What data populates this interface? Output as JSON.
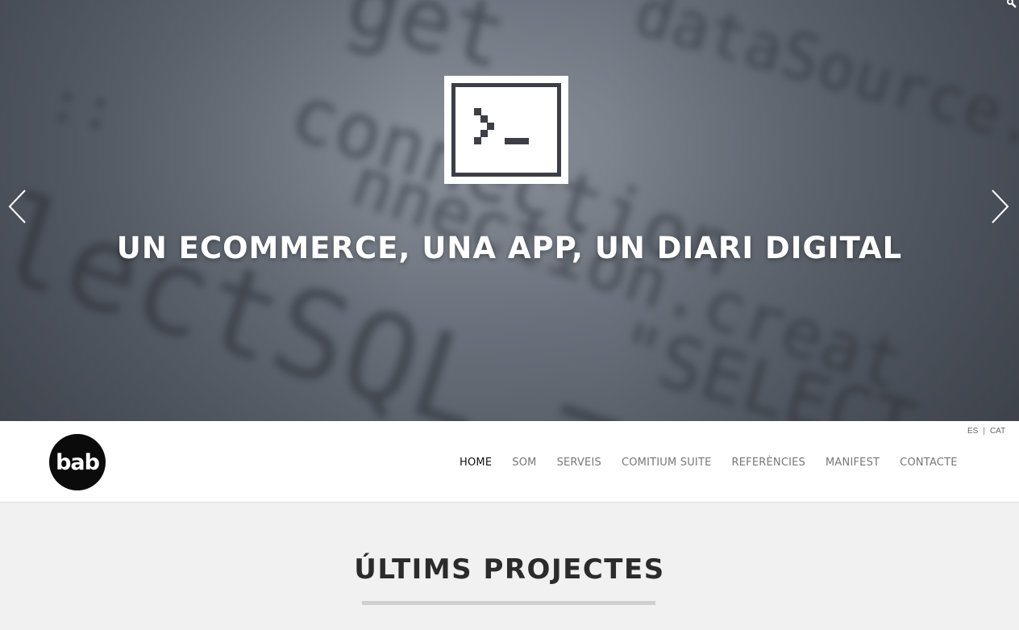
{
  "hero": {
    "headline": "UN ECOMMERCE, UNA APP, UN DIARI DIGITAL",
    "icon": "terminal-icon",
    "prev_icon": "chevron-left-icon",
    "next_icon": "chevron-right-icon"
  },
  "header": {
    "logo_text": "bab",
    "languages": {
      "es": "ES",
      "separator": "|",
      "cat": "CAT"
    },
    "nav": [
      {
        "label": "HOME",
        "active": true
      },
      {
        "label": "SOM",
        "active": false
      },
      {
        "label": "SERVEIS",
        "active": false
      },
      {
        "label": "COMITIUM SUITE",
        "active": false
      },
      {
        "label": "REFERÈNCIES",
        "active": false
      },
      {
        "label": "MANIFEST",
        "active": false
      },
      {
        "label": "CONTACTE",
        "active": false
      }
    ]
  },
  "main": {
    "section_title": "ÚLTIMS PROJECTES"
  },
  "colors": {
    "nav_active": "#111111",
    "nav_inactive": "#777777",
    "logo_bg": "#0b0b0b",
    "page_bg": "#f1f1f1"
  }
}
